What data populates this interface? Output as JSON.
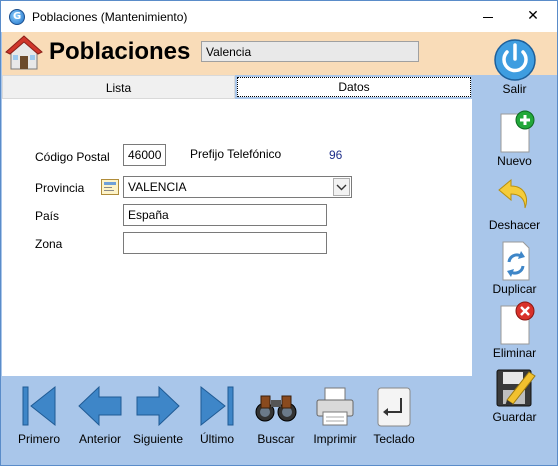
{
  "window": {
    "title": "Poblaciones (Mantenimiento)",
    "minimize_glyph": "",
    "close_glyph": "✕"
  },
  "header": {
    "title": "Poblaciones",
    "current_record": "Valencia"
  },
  "tabs": [
    {
      "label": "Lista",
      "active": false
    },
    {
      "label": "Datos",
      "active": true
    }
  ],
  "form": {
    "codigo_postal_label": "Código Postal",
    "codigo_postal_value": "46000",
    "prefijo_label": "Prefijo Telefónico",
    "prefijo_value": "96",
    "provincia_label": "Provincia",
    "provincia_value": "VALENCIA",
    "pais_label": "País",
    "pais_value": "España",
    "zona_label": "Zona",
    "zona_value": ""
  },
  "sidebar": {
    "salir": "Salir",
    "nuevo": "Nuevo",
    "deshacer": "Deshacer",
    "duplicar": "Duplicar",
    "eliminar": "Eliminar",
    "guardar": "Guardar"
  },
  "toolbar": {
    "primero": "Primero",
    "anterior": "Anterior",
    "siguiente": "Siguiente",
    "ultimo": "Último",
    "buscar": "Buscar",
    "imprimir": "Imprimir",
    "teclado": "Teclado"
  },
  "colors": {
    "header_band": "#f9dcb8",
    "toolbar_bg": "#a9c6ea",
    "nav_arrow": "#3e86c8"
  }
}
